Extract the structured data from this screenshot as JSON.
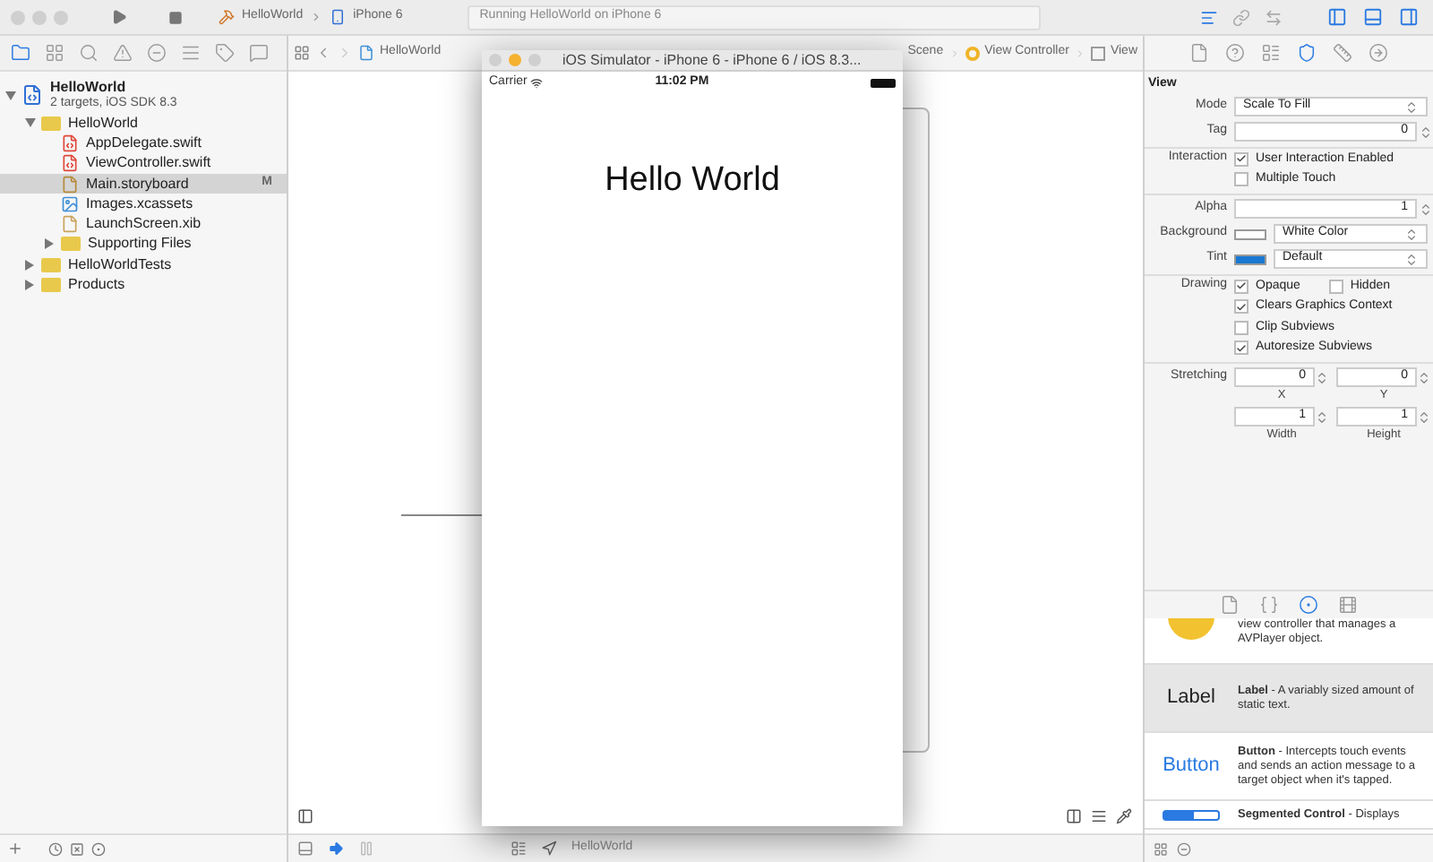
{
  "toolbar": {
    "scheme": "HelloWorld",
    "device": "iPhone 6",
    "status": "Running HelloWorld on iPhone 6",
    "editor_modes": [
      {
        "kind": "standard",
        "selected": true
      },
      {
        "kind": "assistant",
        "selected": false
      },
      {
        "kind": "version",
        "selected": false
      }
    ],
    "panels": [
      {
        "kind": "left",
        "on": true
      },
      {
        "kind": "bottom",
        "on": true
      },
      {
        "kind": "right",
        "on": true
      }
    ]
  },
  "navigator": {
    "tabs": [
      {
        "kind": "folder",
        "selected": true
      },
      {
        "kind": "symbols",
        "selected": false
      },
      {
        "kind": "search",
        "selected": false
      },
      {
        "kind": "issues",
        "selected": false
      },
      {
        "kind": "tests",
        "selected": false
      },
      {
        "kind": "debug",
        "selected": false
      },
      {
        "kind": "breakpoints",
        "selected": false
      },
      {
        "kind": "reports",
        "selected": false
      }
    ],
    "tree": [
      {
        "kind": "project",
        "name": "HelloWorld",
        "subtitle": "2 targets, iOS SDK 8.3",
        "expanded": true,
        "selected": false,
        "children": [
          {
            "kind": "folder",
            "name": "HelloWorld",
            "expanded": true,
            "selected": false,
            "children": [
              {
                "kind": "swift",
                "name": "AppDelegate.swift",
                "selected": false
              },
              {
                "kind": "swift",
                "name": "ViewController.swift",
                "selected": false
              },
              {
                "kind": "storyboard",
                "name": "Main.storyboard",
                "badge": "M",
                "selected": true
              },
              {
                "kind": "assets",
                "name": "Images.xcassets",
                "selected": false
              },
              {
                "kind": "xib",
                "name": "LaunchScreen.xib",
                "selected": false
              },
              {
                "kind": "folder",
                "name": "Supporting Files",
                "expanded": false,
                "selected": false
              }
            ]
          },
          {
            "kind": "folder",
            "name": "HelloWorldTests",
            "expanded": false,
            "selected": false
          },
          {
            "kind": "folder",
            "name": "Products",
            "expanded": false,
            "selected": false
          }
        ]
      }
    ]
  },
  "editor": {
    "breadcrumbs": [
      {
        "kind": "file",
        "label": "HelloWorld"
      },
      {
        "kind": "scene",
        "label": "Scene"
      },
      {
        "kind": "controller",
        "label": "View Controller"
      },
      {
        "kind": "view",
        "label": "View"
      }
    ],
    "debug_target": "HelloWorld"
  },
  "simulator": {
    "title": "iOS Simulator - iPhone 6 - iPhone 6 / iOS 8.3...",
    "carrier": "Carrier",
    "time": "11:02 PM",
    "label": "Hello World"
  },
  "inspector": {
    "tabs": [
      {
        "kind": "file",
        "selected": false
      },
      {
        "kind": "help",
        "selected": false
      },
      {
        "kind": "identity",
        "selected": false
      },
      {
        "kind": "attributes",
        "selected": true
      },
      {
        "kind": "size",
        "selected": false
      },
      {
        "kind": "connections",
        "selected": false
      }
    ],
    "title": "View",
    "groups": [
      [
        {
          "kind": "select",
          "label": "Mode",
          "value": "Scale To Fill"
        },
        {
          "kind": "number",
          "label": "Tag",
          "value": "0"
        }
      ],
      [
        {
          "kind": "checks",
          "label": "Interaction",
          "rows": [
            [
              {
                "label": "User Interaction Enabled",
                "checked": true
              }
            ],
            [
              {
                "label": "Multiple Touch",
                "checked": false
              }
            ]
          ]
        }
      ],
      [
        {
          "kind": "number",
          "label": "Alpha",
          "value": "1"
        },
        {
          "kind": "color",
          "label": "Background",
          "value": "White Color",
          "color": "#ffffff"
        },
        {
          "kind": "color",
          "label": "Tint",
          "value": "Default",
          "color": "#1a78d2"
        }
      ],
      [
        {
          "kind": "checks",
          "label": "Drawing",
          "rows": [
            [
              {
                "label": "Opaque",
                "checked": true
              },
              {
                "label": "Hidden",
                "checked": false
              }
            ],
            [
              {
                "label": "Clears Graphics Context",
                "checked": true
              }
            ],
            [
              {
                "label": "Clip Subviews",
                "checked": false
              }
            ],
            [
              {
                "label": "Autoresize Subviews",
                "checked": true
              }
            ]
          ]
        }
      ],
      [
        {
          "kind": "pair",
          "label": "Stretching",
          "fields": [
            {
              "value": "0",
              "caption": "X"
            },
            {
              "value": "0",
              "caption": "Y"
            }
          ]
        },
        {
          "kind": "pair",
          "fields": [
            {
              "value": "1",
              "caption": "Width"
            },
            {
              "value": "1",
              "caption": "Height"
            }
          ]
        }
      ]
    ]
  },
  "library": {
    "tabs": [
      {
        "kind": "file",
        "selected": false
      },
      {
        "kind": "code",
        "selected": false
      },
      {
        "kind": "object",
        "selected": true
      },
      {
        "kind": "media",
        "selected": false
      }
    ],
    "items": [
      {
        "kind": "player",
        "text": "view controller that manages a AVPlayer object.",
        "selected": false
      },
      {
        "kind": "label",
        "preview": "Label",
        "text": "**Label** - A variably sized amount of static text.",
        "selected": true
      },
      {
        "kind": "button",
        "preview": "Button",
        "text": "**Button** - Intercepts touch events and sends an action message to a target object when it's tapped.",
        "selected": false
      },
      {
        "kind": "segmented",
        "text": "**Segmented Control** - Displays",
        "selected": false
      }
    ]
  }
}
